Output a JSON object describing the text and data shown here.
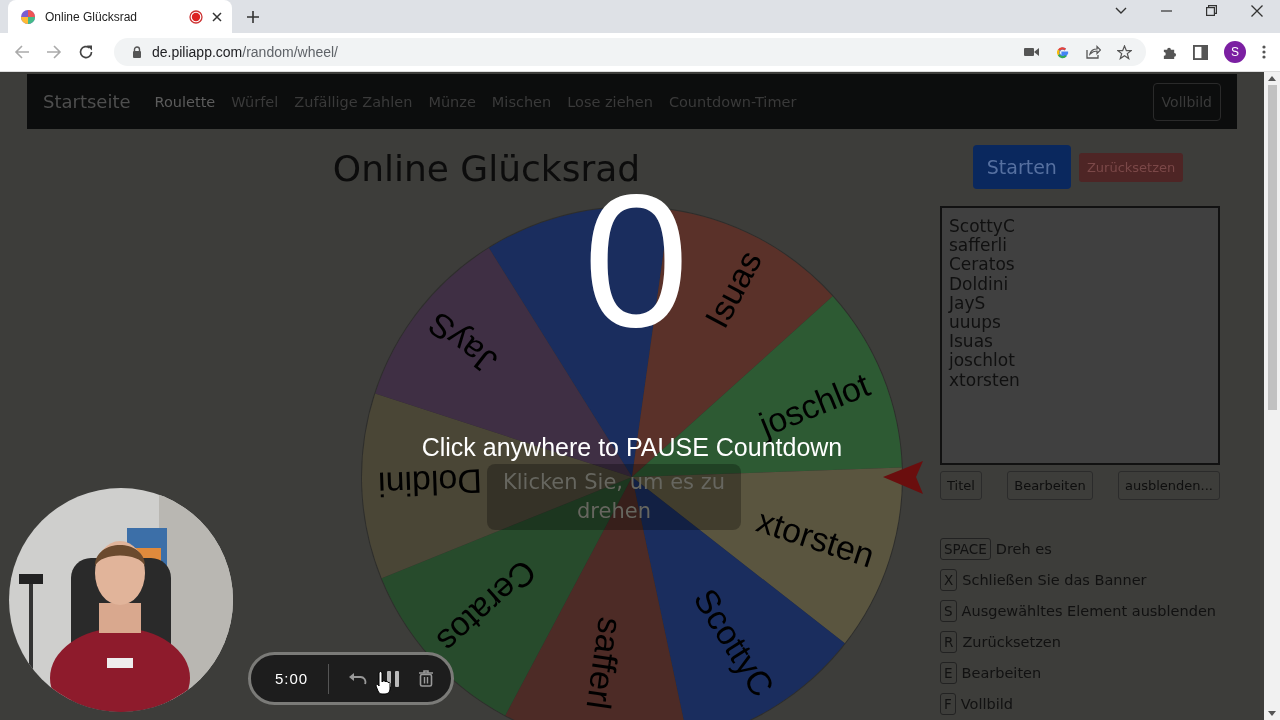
{
  "browser": {
    "tab": {
      "title": "Online Glücksrad",
      "recording": true
    },
    "url": {
      "domain": "de.piliapp.com",
      "path": "/random/wheel/"
    },
    "profile": "S"
  },
  "navbar": {
    "brand": "Startseite",
    "items": [
      {
        "label": "Roulette",
        "selected": true
      },
      {
        "label": "Würfel",
        "selected": false
      },
      {
        "label": "Zufällige Zahlen",
        "selected": false
      },
      {
        "label": "Münze",
        "selected": false
      },
      {
        "label": "Mischen",
        "selected": false
      },
      {
        "label": "Lose ziehen",
        "selected": false
      },
      {
        "label": "Countdown-Timer",
        "selected": false
      }
    ],
    "fullscreen_button": "Vollbild"
  },
  "title": "Online Glücksrad",
  "wheel": {
    "segments": [
      {
        "color": "#1a2d5e"
      },
      {
        "label": "Isuas",
        "color": "#5a3129"
      },
      {
        "label": "joschlot",
        "color": "#2d5a33"
      },
      {
        "label": "xtorsten",
        "color": "#5a553f"
      },
      {
        "label": "ScottyC",
        "color": "#1a2d5e"
      },
      {
        "label": "safferl",
        "color": "#4d2b26"
      },
      {
        "label": "Ceratos",
        "color": "#274b2c"
      },
      {
        "label": "Doldini",
        "color": "#4a4636"
      },
      {
        "label": "JayS",
        "color": "#3f2f44"
      }
    ],
    "spin_hint": "Klicken Sie, um es zu drehen"
  },
  "countdown": {
    "digit": "0",
    "message": "Click anywhere to PAUSE Countdown"
  },
  "timer": {
    "time": "5:00"
  },
  "controls": {
    "start_button": "Starten",
    "reset_button": "Zurücksetzen"
  },
  "entries": [
    "ScottyC",
    "safferli",
    "Ceratos",
    "Doldini",
    "JayS",
    "uuups",
    "Isuas",
    "joschlot",
    "xtorsten"
  ],
  "entry_buttons": [
    "Titel",
    "Bearbeiten",
    "ausblenden..."
  ],
  "shortcuts": [
    {
      "key": "SPACE",
      "label": "Dreh es"
    },
    {
      "key": "X",
      "label": "Schließen Sie das Banner"
    },
    {
      "key": "S",
      "label": "Ausgewähltes Element ausblenden"
    },
    {
      "key": "R",
      "label": "Zurücksetzen"
    },
    {
      "key": "E",
      "label": "Bearbeiten"
    },
    {
      "key": "F",
      "label": "Vollbild"
    }
  ]
}
